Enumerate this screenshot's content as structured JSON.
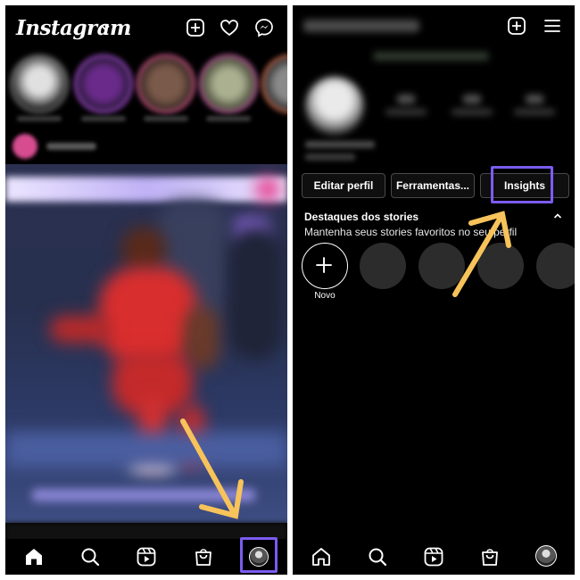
{
  "left_screen": {
    "app_title": "Instagram",
    "icons": {
      "title_chevron": "chevron-down-icon",
      "new_post": "plus-square-icon",
      "activity": "heart-icon",
      "messages": "messenger-icon"
    },
    "bottom_nav": [
      "home-icon",
      "search-icon",
      "reels-icon",
      "shop-icon",
      "profile-avatar"
    ],
    "highlighted_item": "profile-avatar"
  },
  "right_screen": {
    "buttons": {
      "edit_profile": "Editar perfil",
      "tools": "Ferramentas...",
      "insights": "Insights"
    },
    "highlights": {
      "title": "Destaques dos stories",
      "subtitle": "Mantenha seus stories favoritos no seu perfil",
      "new_label": "Novo"
    },
    "icons": {
      "new_post": "plus-square-icon",
      "menu": "hamburger-menu-icon",
      "collapse": "chevron-up-icon",
      "new_highlight": "plus-icon"
    },
    "bottom_nav": [
      "home-icon",
      "search-icon",
      "reels-icon",
      "shop-icon",
      "profile-avatar"
    ],
    "highlighted_item": "insights-button"
  },
  "colors": {
    "background": "#000000",
    "highlight_box": "#7b5cf0",
    "annotation_arrow": "#f7c35a"
  }
}
